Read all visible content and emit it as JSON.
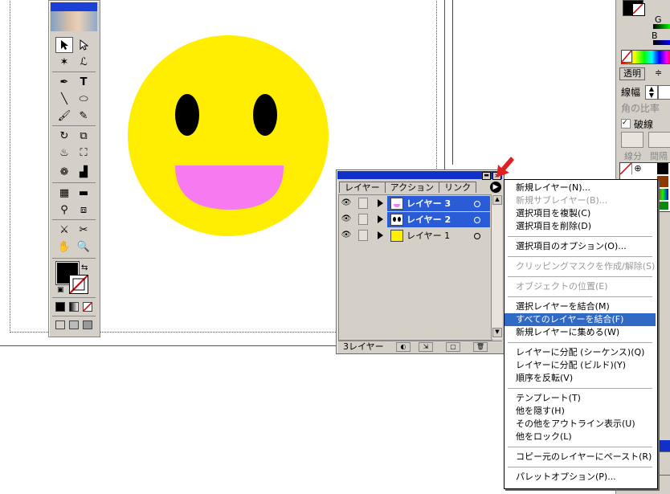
{
  "layers_panel": {
    "tabs": [
      "レイヤー",
      "アクション",
      "リンク"
    ],
    "layers": [
      {
        "name": "レイヤー 3",
        "selected": true,
        "color": "#2a5cd8"
      },
      {
        "name": "レイヤー 2",
        "selected": true,
        "color": "#2a5cd8"
      },
      {
        "name": "レイヤー 1",
        "selected": false,
        "color": "#ffee00"
      }
    ],
    "count_label": "3レイヤー"
  },
  "flyout_menu": {
    "items": [
      {
        "label": "新規レイヤー(N)...",
        "state": "normal"
      },
      {
        "label": "新規サブレイヤー(B)...",
        "state": "disabled"
      },
      {
        "label": "選択項目を複製(C)",
        "state": "normal"
      },
      {
        "label": "選択項目を削除(D)",
        "state": "normal"
      },
      {
        "label": "選択項目のオプション(O)...",
        "state": "normal"
      },
      {
        "label": "クリッピングマスクを作成/解除(S)",
        "state": "disabled"
      },
      {
        "label": "オブジェクトの位置(E)",
        "state": "disabled"
      },
      {
        "label": "選択レイヤーを結合(M)",
        "state": "normal"
      },
      {
        "label": "すべてのレイヤーを結合(F)",
        "state": "highlighted"
      },
      {
        "label": "新規レイヤーに集める(W)",
        "state": "normal"
      },
      {
        "label": "レイヤーに分配 (シーケンス)(Q)",
        "state": "normal"
      },
      {
        "label": "レイヤーに分配 (ビルド)(Y)",
        "state": "normal"
      },
      {
        "label": "順序を反転(V)",
        "state": "normal"
      },
      {
        "label": "テンプレート(T)",
        "state": "normal"
      },
      {
        "label": "他を隠す(H)",
        "state": "normal"
      },
      {
        "label": "その他をアウトライン表示(U)",
        "state": "normal"
      },
      {
        "label": "他をロック(L)",
        "state": "normal"
      },
      {
        "label": "コピー元のレイヤーにペースト(R)",
        "state": "normal"
      },
      {
        "label": "パレットオプション(P)...",
        "state": "normal"
      }
    ]
  },
  "right_panels": {
    "transparency_tab": "透明",
    "stroke_weight_label": "線幅",
    "miter_label": "角の比率",
    "dashed_label": "破線",
    "segment_label": "線分",
    "gap_label": "間隔",
    "g_label": "G",
    "b_label": "B"
  },
  "colors": {
    "smiley_face": "#ffee00",
    "smiley_eyes": "#000000",
    "smiley_mouth": "#f77bf0",
    "selection_blue": "#2a5cd8",
    "menu_highlight": "#316ac5",
    "annotation_arrow": "#e02020"
  }
}
